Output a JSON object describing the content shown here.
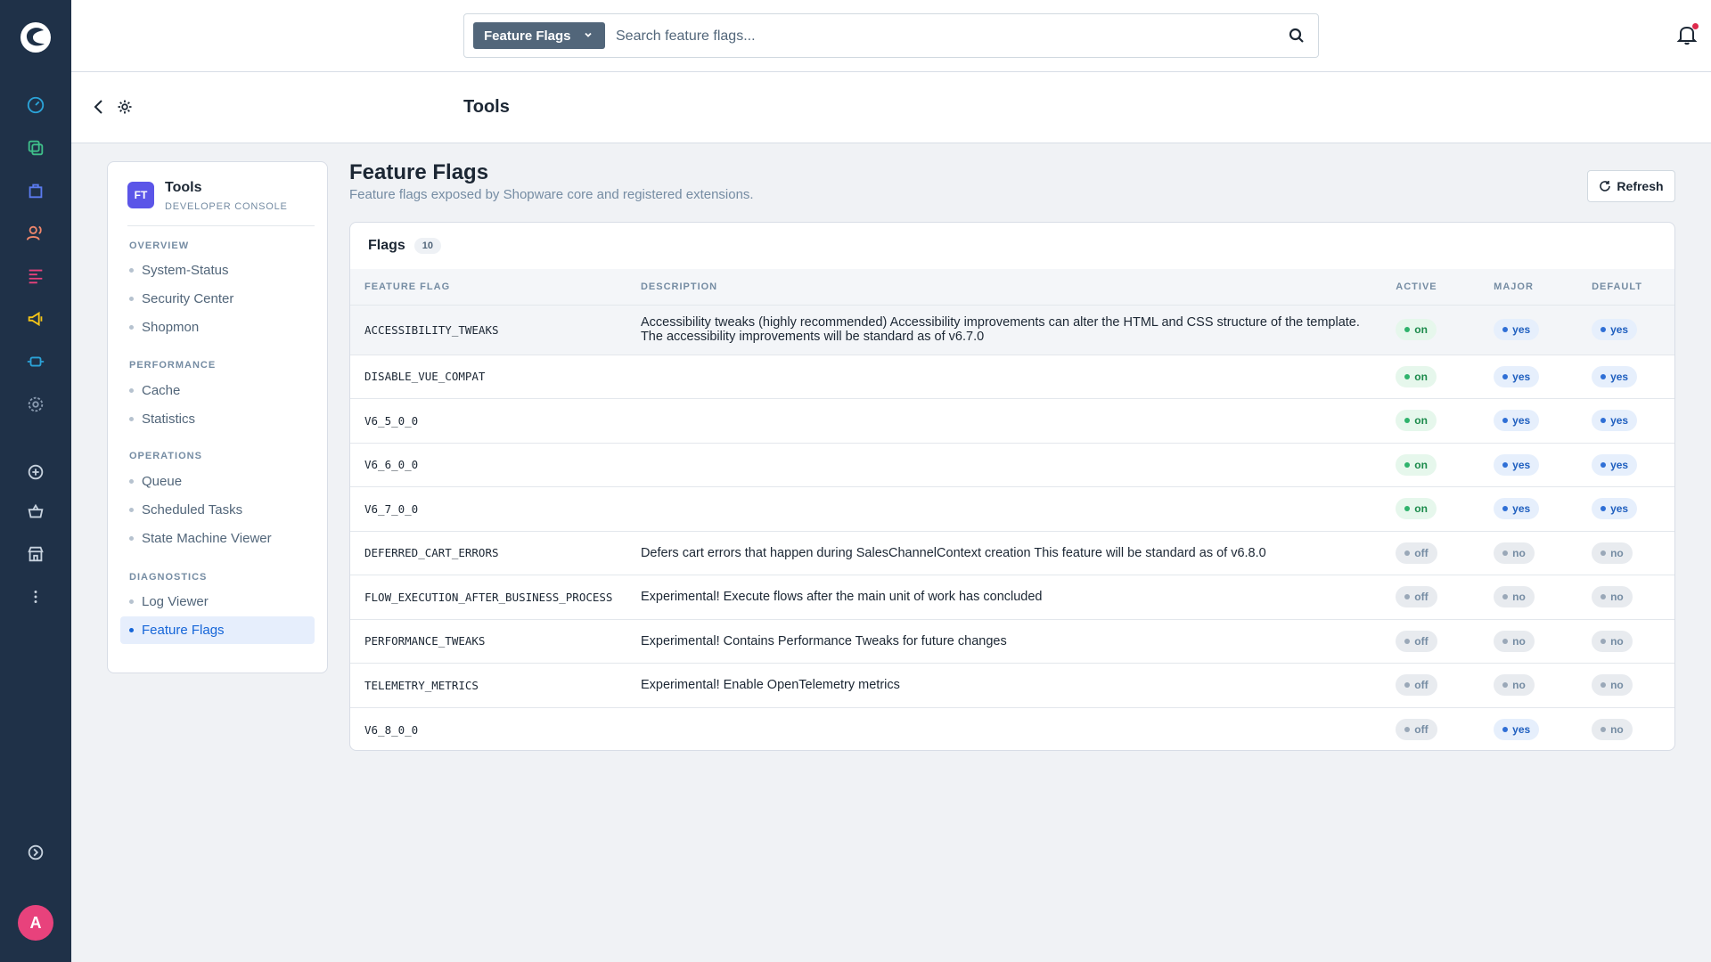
{
  "header": {
    "search_type": "Feature Flags",
    "search_placeholder": "Search feature flags..."
  },
  "subheader": {
    "title": "Tools"
  },
  "sidebar": {
    "badge": "FT",
    "title": "Tools",
    "subtitle": "DEVELOPER CONSOLE",
    "groups": [
      {
        "label": "OVERVIEW",
        "items": [
          "System-Status",
          "Security Center",
          "Shopmon"
        ]
      },
      {
        "label": "PERFORMANCE",
        "items": [
          "Cache",
          "Statistics"
        ]
      },
      {
        "label": "OPERATIONS",
        "items": [
          "Queue",
          "Scheduled Tasks",
          "State Machine Viewer"
        ]
      },
      {
        "label": "DIAGNOSTICS",
        "items": [
          "Log Viewer",
          "Feature Flags"
        ]
      }
    ],
    "active_item": "Feature Flags"
  },
  "main": {
    "title": "Feature Flags",
    "subtitle": "Feature flags exposed by Shopware core and registered extensions.",
    "refresh_label": "Refresh",
    "card_title": "Flags",
    "count": "10",
    "columns": [
      "FEATURE FLAG",
      "DESCRIPTION",
      "ACTIVE",
      "MAJOR",
      "DEFAULT"
    ],
    "rows": [
      {
        "flag": "ACCESSIBILITY_TWEAKS",
        "description": "Accessibility tweaks (highly recommended) Accessibility improvements can alter the HTML and CSS structure of the template. The accessibility improvements will be standard as of v6.7.0",
        "active": "on",
        "major": "yes",
        "default": "yes"
      },
      {
        "flag": "DISABLE_VUE_COMPAT",
        "description": "",
        "active": "on",
        "major": "yes",
        "default": "yes"
      },
      {
        "flag": "V6_5_0_0",
        "description": "",
        "active": "on",
        "major": "yes",
        "default": "yes"
      },
      {
        "flag": "V6_6_0_0",
        "description": "",
        "active": "on",
        "major": "yes",
        "default": "yes"
      },
      {
        "flag": "V6_7_0_0",
        "description": "",
        "active": "on",
        "major": "yes",
        "default": "yes"
      },
      {
        "flag": "DEFERRED_CART_ERRORS",
        "description": "Defers cart errors that happen during SalesChannelContext creation This feature will be standard as of v6.8.0",
        "active": "off",
        "major": "no",
        "default": "no"
      },
      {
        "flag": "FLOW_EXECUTION_AFTER_BUSINESS_PROCESS",
        "description": "Experimental! Execute flows after the main unit of work has concluded",
        "active": "off",
        "major": "no",
        "default": "no"
      },
      {
        "flag": "PERFORMANCE_TWEAKS",
        "description": "Experimental! Contains Performance Tweaks for future changes",
        "active": "off",
        "major": "no",
        "default": "no"
      },
      {
        "flag": "TELEMETRY_METRICS",
        "description": "Experimental! Enable OpenTelemetry metrics",
        "active": "off",
        "major": "no",
        "default": "no"
      },
      {
        "flag": "V6_8_0_0",
        "description": "",
        "active": "off",
        "major": "yes",
        "default": "no"
      }
    ]
  },
  "user": {
    "avatar_initial": "A"
  },
  "colors": {
    "rail": "#1f3148",
    "accent": "#1565d8",
    "on": "#2fb36c",
    "yes": "#2f6fd6",
    "notification": "#de294c"
  },
  "icons": {
    "rail": [
      "dashboard-icon",
      "catalogue-icon",
      "orders-icon",
      "customers-icon",
      "content-icon",
      "marketing-icon",
      "extensions-icon",
      "settings-icon",
      "add-icon",
      "basket-icon",
      "store-icon",
      "more-icon",
      "expand-icon"
    ]
  }
}
